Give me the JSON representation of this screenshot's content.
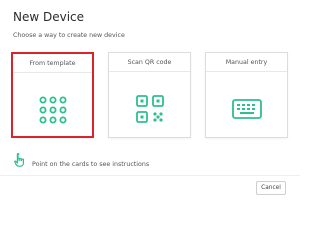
{
  "dialog": {
    "title": "New Device",
    "subtitle": "Choose a way to create new device"
  },
  "cards": [
    {
      "label": "From template",
      "icon": "dots-grid-icon",
      "selected": true
    },
    {
      "label": "Scan QR code",
      "icon": "qr-code-icon",
      "selected": false
    },
    {
      "label": "Manual entry",
      "icon": "keyboard-icon",
      "selected": false
    }
  ],
  "hint": {
    "icon": "pointing-hand-icon",
    "text": "Point on the cards to see instructions"
  },
  "footer": {
    "cancel_label": "Cancel"
  },
  "colors": {
    "accent": "#2ec08c",
    "selection_border": "#d9242b"
  }
}
